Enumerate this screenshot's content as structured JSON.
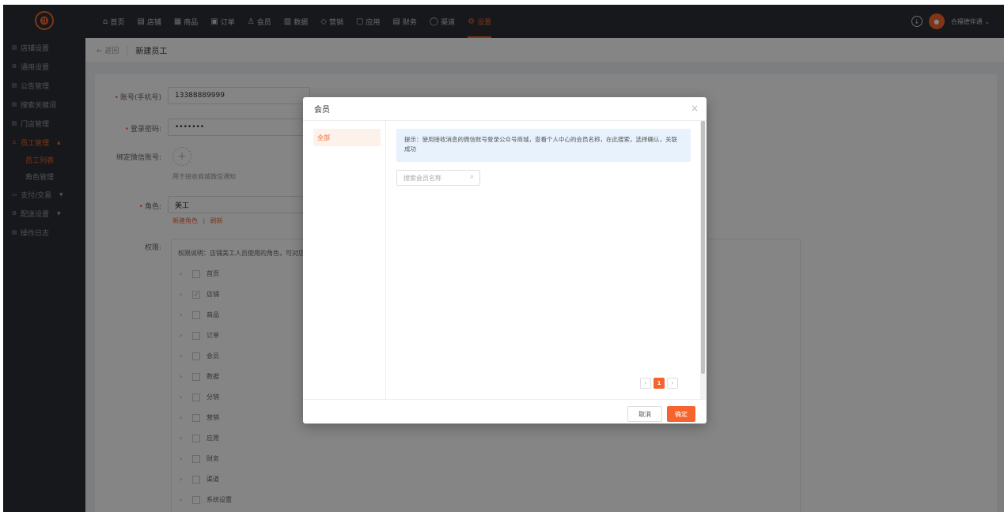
{
  "topbar": {
    "logo": "⓫",
    "nav": [
      {
        "label": "首页",
        "icon": "home-icon",
        "glyph": "⌂",
        "active": false
      },
      {
        "label": "店铺",
        "icon": "store-icon",
        "glyph": "▤",
        "active": false
      },
      {
        "label": "商品",
        "icon": "goods-icon",
        "glyph": "▦",
        "active": false
      },
      {
        "label": "订单",
        "icon": "order-icon",
        "glyph": "▣",
        "active": false
      },
      {
        "label": "会员",
        "icon": "member-icon",
        "glyph": "♙",
        "active": false
      },
      {
        "label": "数据",
        "icon": "data-icon",
        "glyph": "▥",
        "active": false
      },
      {
        "label": "营销",
        "icon": "marketing-icon",
        "glyph": "◇",
        "active": false
      },
      {
        "label": "应用",
        "icon": "app-icon",
        "glyph": "▢",
        "active": false
      },
      {
        "label": "财务",
        "icon": "finance-icon",
        "glyph": "▤",
        "active": false
      },
      {
        "label": "渠道",
        "icon": "channel-icon",
        "glyph": "◯",
        "active": false
      },
      {
        "label": "设置",
        "icon": "settings-icon",
        "glyph": "⚙",
        "active": true
      }
    ],
    "username": "合福德伴通 ⌄"
  },
  "sidebar": {
    "items": [
      {
        "label": "店铺设置",
        "glyph": "▤"
      },
      {
        "label": "通用设置",
        "glyph": "⚙"
      },
      {
        "label": "公告管理",
        "glyph": "▤"
      },
      {
        "label": "搜索关键词",
        "glyph": "▤"
      },
      {
        "label": "门店管理",
        "glyph": "▤"
      },
      {
        "label": "员工管理",
        "glyph": "♙",
        "arrow": "▲"
      },
      {
        "label": "员工列表",
        "sub": true
      },
      {
        "label": "角色管理",
        "sub": true
      },
      {
        "label": "支付/交易",
        "glyph": "▭",
        "arrow": "▼"
      },
      {
        "label": "配送设置",
        "glyph": "⚙",
        "arrow": "▼"
      },
      {
        "label": "操作日志",
        "glyph": "▤"
      }
    ]
  },
  "breadcrumb": {
    "back": "← 返回",
    "title": "新建员工"
  },
  "form": {
    "account_label": "账号(手机号)",
    "account_value": "13388889999",
    "password_label": "登录密码:",
    "password_value": "•••••••",
    "wechat_label": "绑定微信账号:",
    "wechat_hint": "用于接收商城微信通知",
    "role_label": "角色:",
    "role_value": "美工",
    "role_new": "新建角色",
    "role_sep": "|",
    "role_refresh": "刷新",
    "perm_label": "权限:",
    "perm_desc": "权限说明：店铺美工人员使用的角色，可对店铺",
    "perm_items": [
      "首页",
      "店铺",
      "商品",
      "订单",
      "会员",
      "数据",
      "分销",
      "营销",
      "应用",
      "财务",
      "渠道",
      "系统设置"
    ]
  },
  "modal": {
    "title": "会员",
    "close": "×",
    "tab_all": "全部",
    "tip": "提示：使用接收消息的微信账号登录公众号商城，查看个人中心的会员名称，在此搜索，选择确认，关联成功",
    "search_placeholder": "搜索会员名称",
    "pager": {
      "prev": "‹",
      "current": "1",
      "next": "›"
    },
    "cancel": "取消",
    "confirm": "确定"
  }
}
